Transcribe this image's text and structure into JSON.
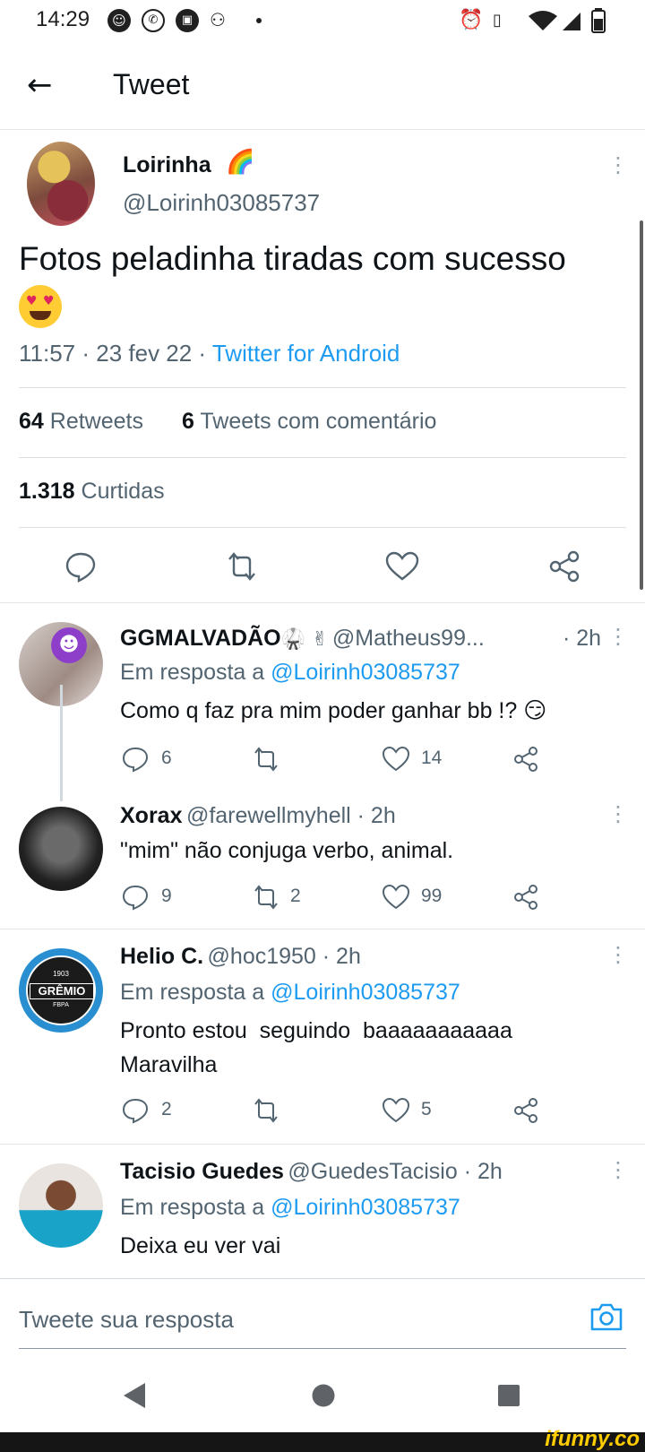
{
  "status_bar": {
    "time": "14:29",
    "left_icons": [
      "smiley-icon",
      "whatsapp-icon",
      "notification-icon",
      "dot-icon"
    ],
    "right_icons": [
      "alarm-icon",
      "vibrate-icon",
      "wifi-icon",
      "signal-icon",
      "battery-icon"
    ]
  },
  "header": {
    "title": "Tweet"
  },
  "main_tweet": {
    "name": "Loirinha",
    "name_emoji": "🌈",
    "handle": "@Loirinh03085737",
    "text": "Fotos peladinha tiradas com sucesso",
    "timestamp": "11:57 · 23 fev 22 · ",
    "source": "Twitter for Android",
    "retweets_count": "64",
    "retweets_label": "Retweets",
    "quotes_count": "6",
    "quotes_label": "Tweets com comentário",
    "likes_count": "1.318",
    "likes_label": "Curtidas"
  },
  "replies": [
    {
      "name": "GGMALVADÃO",
      "name_emojis": "🥋 ✌",
      "handle": "@Matheus99...",
      "time": "· 2h",
      "reply_prefix": "Em resposta a ",
      "reply_to": "@Loirinh03085737",
      "text": "Como q faz pra mim poder ganhar bb !? 😏",
      "reply_count": "6",
      "retweet_count": "",
      "like_count": "14"
    },
    {
      "name": "Xorax",
      "handle": "@farewellmyhell · 2h",
      "text": "\"mim\" não conjuga verbo, animal.",
      "reply_count": "9",
      "retweet_count": "2",
      "like_count": "99"
    },
    {
      "name": "Helio C.",
      "handle": "@hoc1950 · 2h",
      "reply_prefix": "Em resposta a ",
      "reply_to": "@Loirinh03085737",
      "text_line1": "Pronto estou  seguindo  baaaaaaaaaaa",
      "text_line2": "Maravilha",
      "avatar_label": "GRÊMIO",
      "avatar_year": "1903",
      "avatar_sub": "FBPA",
      "reply_count": "2",
      "retweet_count": "",
      "like_count": "5"
    },
    {
      "name": "Tacisio Guedes",
      "handle": "@GuedesTacisio · 2h",
      "reply_prefix": "Em resposta a ",
      "reply_to": "@Loirinh03085737",
      "text": "Deixa eu ver vai"
    }
  ],
  "reply_bar": {
    "placeholder": "Tweete sua resposta"
  },
  "watermark": "ifunny.co",
  "colors": {
    "link": "#1d9bf0",
    "secondary_text": "#536471",
    "primary_text": "#0f1419"
  }
}
